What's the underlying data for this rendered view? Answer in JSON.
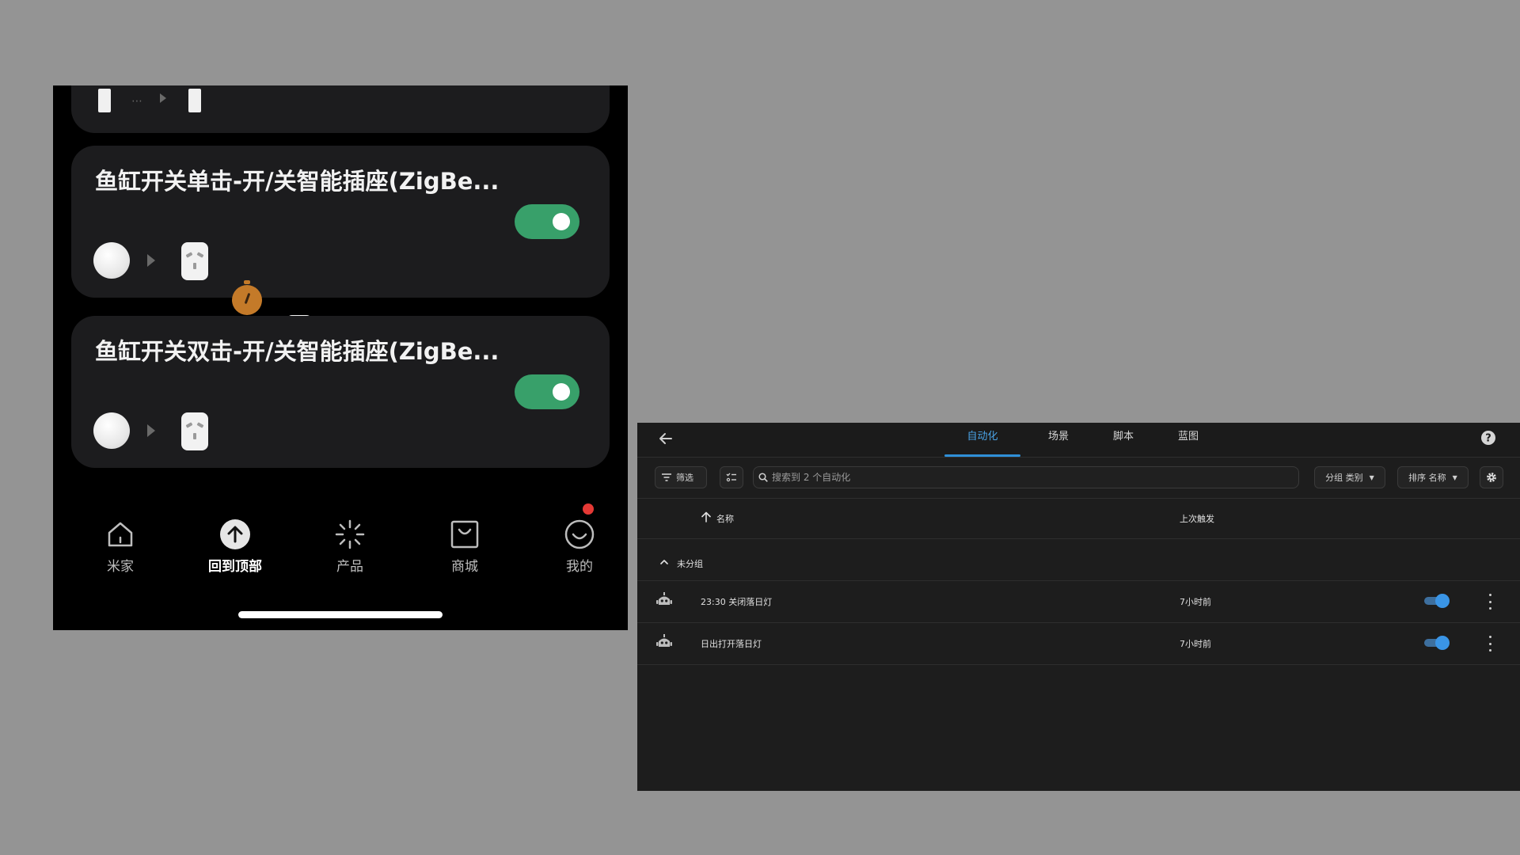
{
  "phone": {
    "cards": [
      {
        "title": "鱼缸开关单击-开/关智能插座(ZigBe...",
        "enabled": true
      },
      {
        "title": "鱼缸开关双击-开/关智能插座(ZigBe...",
        "enabled": true
      }
    ],
    "nav": [
      {
        "label": "米家",
        "icon": "home-icon"
      },
      {
        "label": "回到顶部",
        "icon": "arrow-up-circle-icon"
      },
      {
        "label": "产品",
        "icon": "sparkle-icon"
      },
      {
        "label": "商城",
        "icon": "shopping-bag-icon"
      },
      {
        "label": "我的",
        "icon": "smiley-icon"
      }
    ]
  },
  "ha": {
    "tabs": [
      "自动化",
      "场景",
      "脚本",
      "蓝图"
    ],
    "active_tab": "自动化",
    "toolbar": {
      "filter_label": "筛选",
      "search_placeholder": "搜索到 2 个自动化",
      "group_label": "分组 类别",
      "sort_label": "排序 名称"
    },
    "columns": {
      "name": "名称",
      "last_triggered": "上次触发"
    },
    "group": {
      "label": "未分组"
    },
    "rows": [
      {
        "name": "23:30 关闭落日灯",
        "last_triggered": "7小时前",
        "enabled": true
      },
      {
        "name": "日出打开落日灯",
        "last_triggered": "7小时前",
        "enabled": true
      }
    ],
    "accent": "#2f8fd8"
  }
}
